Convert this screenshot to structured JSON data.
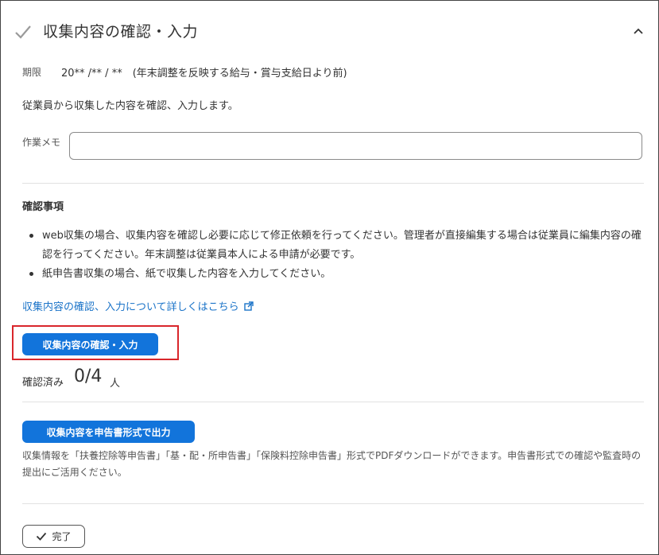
{
  "section": {
    "title": "収集内容の確認・入力",
    "deadline_label": "期限",
    "deadline_value": "20** /** / **　(年末調整を反映する給与・賞与支給日より前)",
    "description": "従業員から収集した内容を確認、入力します。"
  },
  "memo": {
    "label": "作業メモ",
    "value": "",
    "placeholder": ""
  },
  "confirmation": {
    "heading": "確認事項",
    "items": [
      "web収集の場合、収集内容を確認し必要に応じて修正依頼を行ってください。管理者が直接編集する場合は従業員に編集内容の確認を行ってください。年末調整は従業員本人による申請が必要です。",
      "紙申告書収集の場合、紙で収集した内容を入力してください。"
    ],
    "help_link": "収集内容の確認、入力について詳しくはこちら"
  },
  "actions": {
    "confirm_button": "収集内容の確認・入力",
    "confirmed_label": "確認済み",
    "confirmed_count": "0/4",
    "confirmed_unit": "人",
    "export_button": "収集内容を申告書形式で出力",
    "export_note": "収集情報を「扶養控除等申告書」「基・配・所申告書」「保険料控除申告書」形式でPDFダウンロードができます。申告書形式での確認や監査時の提出にご活用ください。",
    "done_button": "完了"
  },
  "colors": {
    "accent": "#1274db",
    "link": "#1a73c8",
    "highlight": "#d9262b",
    "check_mark": "#9a9a9a"
  },
  "icons": {
    "header_status": "check-icon",
    "collapse": "chevron-up-icon",
    "link": "external-link-icon",
    "done": "check-icon"
  }
}
